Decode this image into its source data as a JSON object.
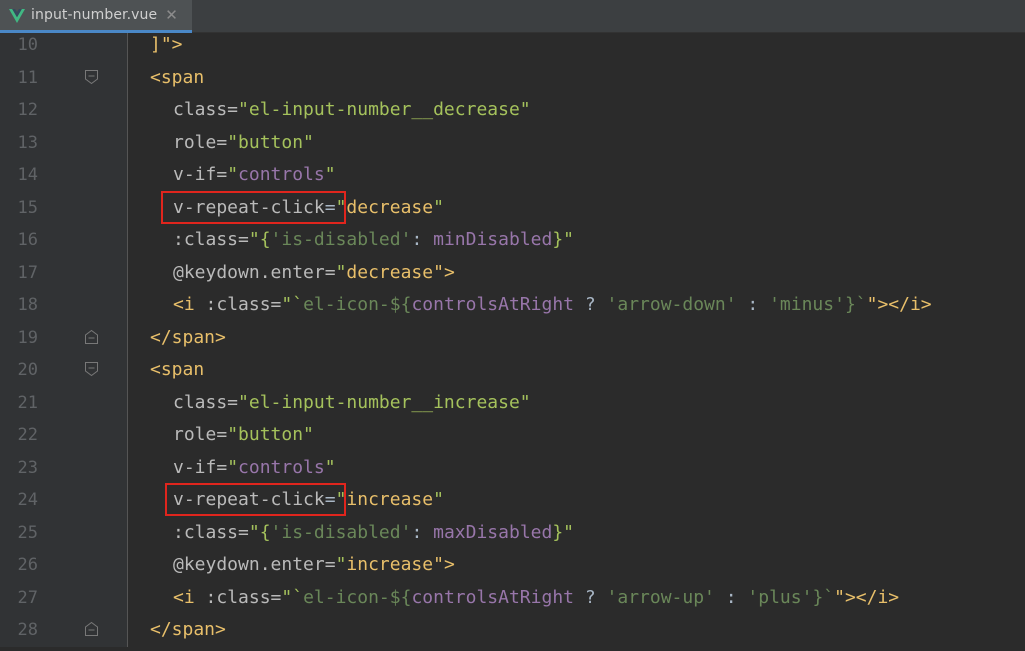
{
  "tab": {
    "filename": "input-number.vue",
    "close": "✕"
  },
  "lines": [
    {
      "num": "10",
      "fold": "none"
    },
    {
      "num": "11",
      "fold": "open"
    },
    {
      "num": "12",
      "fold": "none"
    },
    {
      "num": "13",
      "fold": "none"
    },
    {
      "num": "14",
      "fold": "none"
    },
    {
      "num": "15",
      "fold": "none"
    },
    {
      "num": "16",
      "fold": "none"
    },
    {
      "num": "17",
      "fold": "none"
    },
    {
      "num": "18",
      "fold": "none"
    },
    {
      "num": "19",
      "fold": "close"
    },
    {
      "num": "20",
      "fold": "open"
    },
    {
      "num": "21",
      "fold": "none"
    },
    {
      "num": "22",
      "fold": "none"
    },
    {
      "num": "23",
      "fold": "none"
    },
    {
      "num": "24",
      "fold": "none"
    },
    {
      "num": "25",
      "fold": "none"
    },
    {
      "num": "26",
      "fold": "none"
    },
    {
      "num": "27",
      "fold": "none"
    },
    {
      "num": "28",
      "fold": "close"
    }
  ],
  "code": {
    "l10": "]\">",
    "l11_tag": "<span",
    "l12_attr": "class=",
    "l12_val": "\"el-input-number__decrease\"",
    "l13_attr": "role=",
    "l13_val": "\"button\"",
    "l14_attr": "v-if=",
    "l14_q1": "\"",
    "l14_val": "controls",
    "l14_q2": "\"",
    "l15_attr": "v-repeat-click",
    "l15_eq": "=",
    "l15_q1": "\"",
    "l15_val": "decrease",
    "l15_q2": "\"",
    "l16_attr": ":class=",
    "l16_a": "\"{",
    "l16_key": "'is-disabled'",
    "l16_colon": ": ",
    "l16_ident": "minDisabled",
    "l16_b": "}\"",
    "l17_attr": "@keydown.enter=",
    "l17_q1": "\"",
    "l17_val": "decrease",
    "l17_q2": "\">",
    "l18_open": "<i ",
    "l18_attr": ":class=",
    "l18_q1": "\"`",
    "l18_tpl": "el-icon-${",
    "l18_ident": "controlsAtRight",
    "l18_op1": " ? ",
    "l18_s1": "'arrow-down'",
    "l18_op2": " : ",
    "l18_s2": "'minus'",
    "l18_close_tpl": "}`",
    "l18_end": "\"></i>",
    "l19": "</span>",
    "l20_tag": "<span",
    "l21_attr": "class=",
    "l21_val": "\"el-input-number__increase\"",
    "l22_attr": "role=",
    "l22_val": "\"button\"",
    "l23_attr": "v-if=",
    "l23_q1": "\"",
    "l23_val": "controls",
    "l23_q2": "\"",
    "l24_attr": "v-repeat-click",
    "l24_eq": "=",
    "l24_q1": "\"",
    "l24_val": "increase",
    "l24_q2": "\"",
    "l25_attr": ":class=",
    "l25_a": "\"{",
    "l25_key": "'is-disabled'",
    "l25_colon": ": ",
    "l25_ident": "maxDisabled",
    "l25_b": "}\"",
    "l26_attr": "@keydown.enter=",
    "l26_q1": "\"",
    "l26_val": "increase",
    "l26_q2": "\">",
    "l27_open": "<i ",
    "l27_attr": ":class=",
    "l27_q1": "\"`",
    "l27_tpl": "el-icon-${",
    "l27_ident": "controlsAtRight",
    "l27_op1": " ? ",
    "l27_s1": "'arrow-up'",
    "l27_op2": " : ",
    "l27_s2": "'plus'",
    "l27_close_tpl": "}`",
    "l27_end": "\"></i>",
    "l28": "</span>"
  },
  "colors": {
    "background": "#2b2b2b",
    "gutter": "#313335",
    "tag": "#e8bf6a",
    "string": "#a5c25c",
    "identifier": "#9876aa",
    "highlight_box": "#e0251d",
    "tab_accent": "#4a88c7"
  }
}
